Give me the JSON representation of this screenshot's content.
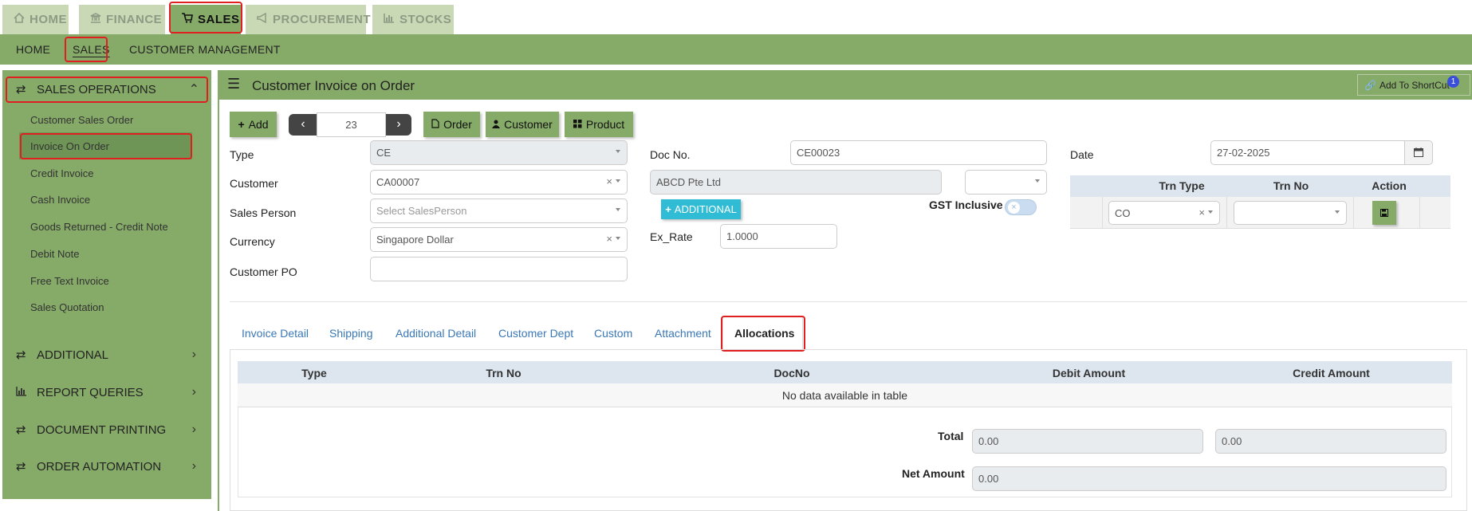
{
  "top_tabs": [
    {
      "label": "HOME",
      "icon": "home-icon"
    },
    {
      "label": "FINANCE",
      "icon": "bank-icon"
    },
    {
      "label": "SALES",
      "icon": "cart-icon"
    },
    {
      "label": "PROCUREMENT",
      "icon": "megaphone-icon"
    },
    {
      "label": "STOCKS",
      "icon": "bar-chart-icon"
    }
  ],
  "sub_nav": [
    "HOME",
    "SALES",
    "CUSTOMER MANAGEMENT"
  ],
  "sidebar": {
    "sales_operations": "SALES OPERATIONS",
    "items": [
      "Customer Sales Order",
      "Invoice On Order",
      "Credit Invoice",
      "Cash Invoice",
      "Goods Returned - Credit Note",
      "Debit Note",
      "Free Text Invoice",
      "Sales Quotation"
    ],
    "sections": [
      "ADDITIONAL",
      "REPORT QUERIES",
      "DOCUMENT PRINTING",
      "ORDER AUTOMATION"
    ]
  },
  "page": {
    "title": "Customer Invoice on Order",
    "shortcut": "Add To ShortCut",
    "shortcut_badge": "1"
  },
  "toolbar": {
    "add": "Add",
    "record_no": "23",
    "order": "Order",
    "customer": "Customer",
    "product": "Product"
  },
  "form": {
    "type_label": "Type",
    "type_value": "CE",
    "customer_label": "Customer",
    "customer_value": "CA00007",
    "sales_person_label": "Sales Person",
    "sales_person_placeholder": "Select SalesPerson",
    "currency_label": "Currency",
    "currency_value": "Singapore Dollar",
    "customer_po_label": "Customer PO",
    "customer_po_value": "",
    "doc_no_label": "Doc No.",
    "doc_no_value": "CE00023",
    "customer_name": "ABCD Pte Ltd",
    "additional_button": "ADDITIONAL",
    "gst_label": "GST Inclusive",
    "ex_rate_label": "Ex_Rate",
    "ex_rate_value": "1.0000",
    "date_label": "Date",
    "date_value": "27-02-2025"
  },
  "trn_table": {
    "headers": [
      "Trn Type",
      "Trn No",
      "Action"
    ],
    "trn_type_value": "CO"
  },
  "tabs": [
    "Invoice Detail",
    "Shipping",
    "Additional Detail",
    "Customer Dept",
    "Custom",
    "Attachment",
    "Allocations"
  ],
  "allocations": {
    "headers": [
      "Type",
      "Trn No",
      "DocNo",
      "Debit Amount",
      "Credit Amount"
    ],
    "empty": "No data available in table",
    "total_label": "Total",
    "total_debit": "0.00",
    "total_credit": "0.00",
    "net_label": "Net Amount",
    "net_value": "0.00"
  },
  "colors": {
    "accent": "#86aa68",
    "tab_inactive": "#c9d9b6",
    "highlight": "#e02020",
    "link": "#3a78b5",
    "teal": "#2fbcd4"
  }
}
